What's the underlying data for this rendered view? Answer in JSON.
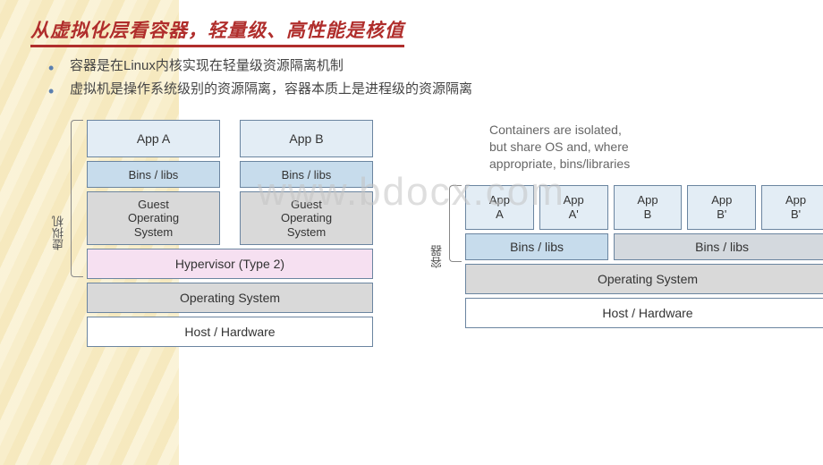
{
  "title": "从虚拟化层看容器，轻量级、高性能是核值",
  "bullets": [
    "容器是在Linux内核实现在轻量级资源隔离机制",
    "虚拟机是操作系统级别的资源隔离，容器本质上是进程级的资源隔离"
  ],
  "watermark": "www.bdocx.com",
  "vm": {
    "side_label": "虚拟机",
    "cols": [
      {
        "app": "App A",
        "bins": "Bins / libs",
        "guest": "Guest\nOperating\nSystem"
      },
      {
        "app": "App B",
        "bins": "Bins / libs",
        "guest": "Guest\nOperating\nSystem"
      }
    ],
    "hypervisor": "Hypervisor (Type 2)",
    "os": "Operating System",
    "host": "Host / Hardware"
  },
  "ct": {
    "side_label": "容器",
    "note": "Containers are isolated,\nbut share OS and, where\nappropriate, bins/libraries",
    "apps": [
      "App\nA",
      "App\nA'",
      "App\nB",
      "App\nB'",
      "App\nB'"
    ],
    "bins1": "Bins / libs",
    "bins2": "Bins / libs",
    "os": "Operating System",
    "host": "Host / Hardware"
  }
}
